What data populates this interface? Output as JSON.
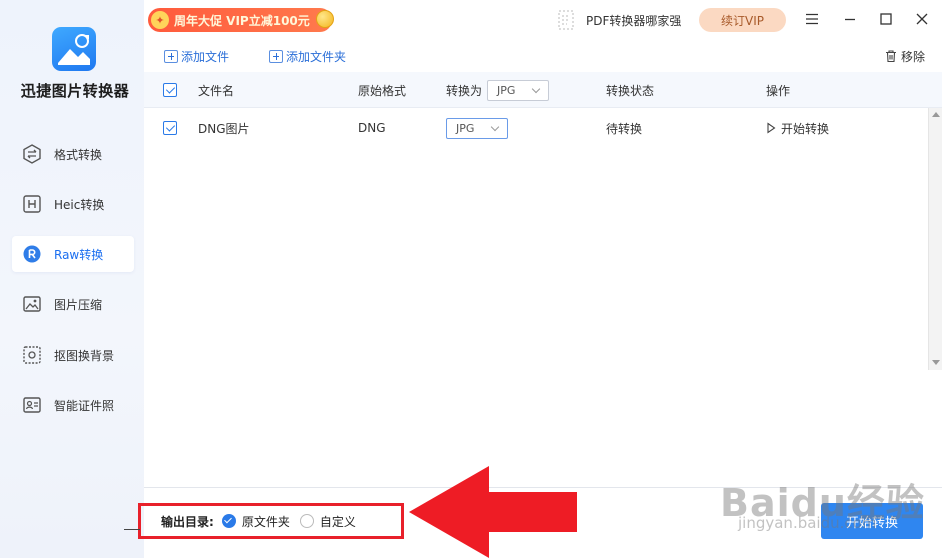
{
  "app": {
    "name": "迅捷图片转换器"
  },
  "sidebar": {
    "items": [
      {
        "label": "格式转换",
        "icon": "format-convert-icon",
        "active": false
      },
      {
        "label": "Heic转换",
        "icon": "heic-icon",
        "active": false
      },
      {
        "label": "Raw转换",
        "icon": "raw-icon",
        "active": true
      },
      {
        "label": "图片压缩",
        "icon": "image-compress-icon",
        "active": false
      },
      {
        "label": "抠图换背景",
        "icon": "cutout-icon",
        "active": false
      },
      {
        "label": "智能证件照",
        "icon": "id-photo-icon",
        "active": false
      }
    ]
  },
  "topbar": {
    "promo": "周年大促 VIP立减100元",
    "pdf_link": "PDF转换器哪家强",
    "vip_button": "续订VIP"
  },
  "toolbar": {
    "add_file": "添加文件",
    "add_folder": "添加文件夹",
    "remove": "移除"
  },
  "table": {
    "headers": {
      "filename": "文件名",
      "original_format": "原始格式",
      "convert_to": "转换为",
      "status": "转换状态",
      "action": "操作"
    },
    "header_select_value": "JPG",
    "rows": [
      {
        "filename": "DNG图片",
        "original_format": "DNG",
        "target_format": "JPG",
        "status": "待转换",
        "action": "开始转换"
      }
    ]
  },
  "bottom": {
    "output_label": "输出目录:",
    "option_original": "原文件夹",
    "option_custom": "自定义",
    "start_button": "开始转换"
  },
  "watermark": {
    "main": "Baidu经验",
    "sub": "jingyan.baidu.com"
  },
  "colors": {
    "accent": "#2f86f0",
    "promo": "#ff5a3c",
    "highlight": "#e8202a"
  }
}
